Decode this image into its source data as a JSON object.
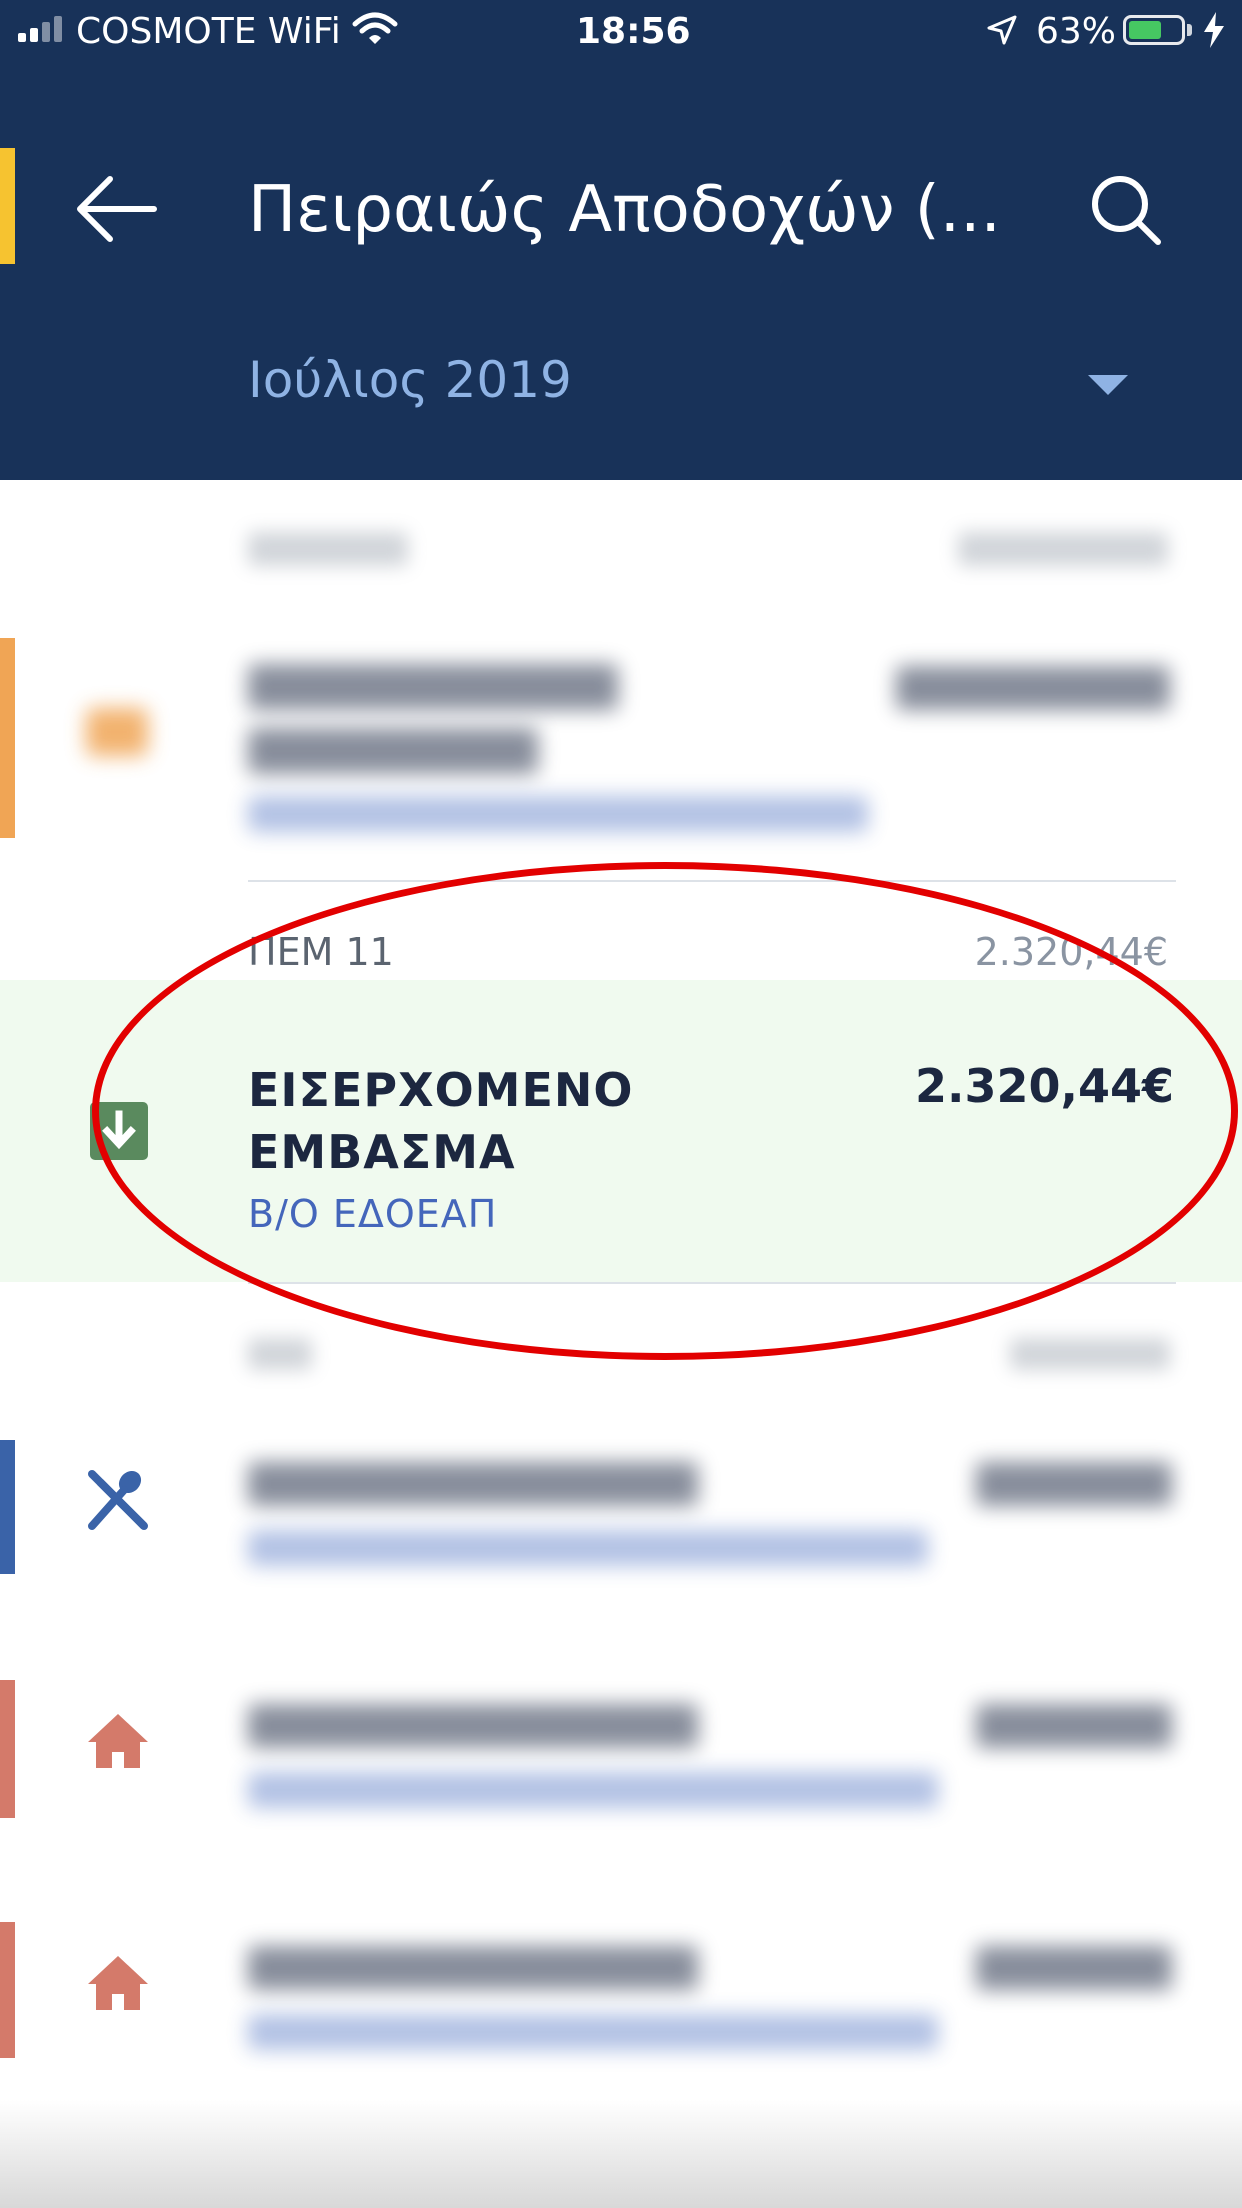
{
  "status_bar": {
    "carrier": "COSMOTE WiFi",
    "time": "18:56",
    "battery_percent": "63%",
    "battery_level": 0.63
  },
  "header": {
    "title": "Πειραιώς Αποδοχών (...",
    "month_selector": "Ιούλιος 2019",
    "icons": [
      "back-arrow-icon",
      "search-icon",
      "chevron-down-icon"
    ],
    "accent_color": "#f6c330",
    "background_color": "#183259"
  },
  "transactions": {
    "highlighted": {
      "date": "ΠΕΜ 11",
      "day_total": "2.320,44€",
      "title_line1": "ΕΙΣΕΡΧΟΜΕΝΟ",
      "title_line2": "ΕΜΒΑΣΜΑ",
      "subtitle": "Β/Ο ΕΔΟΕΑΠ",
      "amount": "2.320,44€",
      "icon": "incoming-download-icon",
      "background_color": "#f0faef"
    },
    "category_colors": {
      "transfer": "#f0a555",
      "restaurant": "#3a63a8",
      "home": "#d47a6a"
    },
    "blurred_icons": [
      "transfer-card-icon",
      "fork-spoon-icon",
      "home-icon",
      "home-icon"
    ]
  },
  "annotation": {
    "shape": "ellipse",
    "color": "#e20000"
  }
}
